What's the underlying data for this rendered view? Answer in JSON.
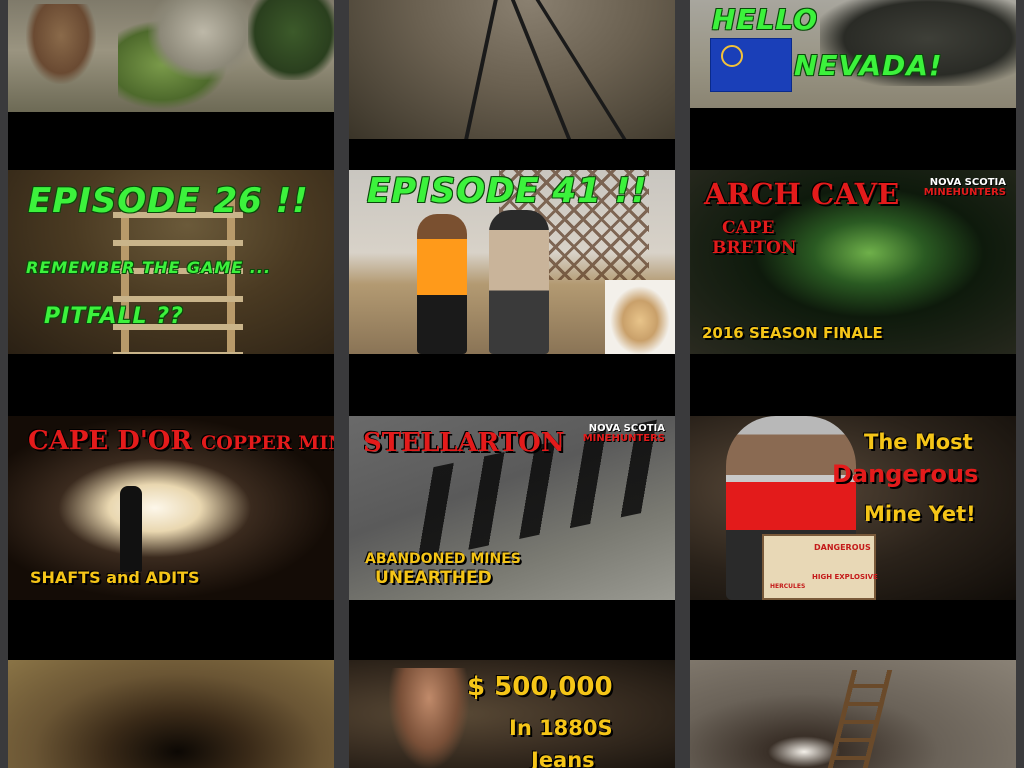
{
  "tiles": [
    {
      "id": "burros",
      "texts": []
    },
    {
      "id": "mine-rails",
      "texts": []
    },
    {
      "id": "hello-nevada",
      "texts": {
        "line1": "HELLO",
        "line2": "NEVADA!"
      }
    },
    {
      "id": "episode-26",
      "texts": {
        "title": "EPISODE 26 !!",
        "line1": "REMEMBER THE GAME ...",
        "line2": "PITFALL ??"
      }
    },
    {
      "id": "episode-41",
      "texts": {
        "title": "EPISODE 41 !!"
      }
    },
    {
      "id": "arch-cave",
      "texts": {
        "title": "ARCH CAVE",
        "sub1": "CAPE",
        "sub2": "BRETON",
        "footer": "2016 SEASON FINALE",
        "brand1": "NOVA SCOTIA",
        "brand2": "MINEHUNTERS"
      }
    },
    {
      "id": "cape-dor",
      "texts": {
        "title_big": "CAPE D'OR",
        "title_small": "COPPER MINES",
        "footer": "SHAFTS and ADITS"
      }
    },
    {
      "id": "stellarton",
      "texts": {
        "title": "STELLARTON",
        "footer1": "ABANDONED MINES",
        "footer2": "UNEARTHED",
        "brand1": "NOVA SCOTIA",
        "brand2": "MINEHUNTERS"
      }
    },
    {
      "id": "most-dangerous",
      "texts": {
        "line1": "The Most",
        "line2": "Dangerous",
        "line3": "Mine Yet!",
        "box1": "DANGEROUS",
        "box2": "HIGH EXPLOSIVE",
        "box3": "HERCULES"
      }
    },
    {
      "id": "tunnel",
      "texts": []
    },
    {
      "id": "500k-jeans",
      "texts": {
        "line1": "$ 500,000",
        "line2": "In 1880S",
        "line3": "Jeans"
      }
    },
    {
      "id": "ladder-shaft",
      "texts": []
    }
  ],
  "colors": {
    "column_background": "#000000",
    "gutter": "#3a3a3c",
    "green_text": "#3cf23c",
    "red_text": "#e31b1b",
    "yellow_text": "#f5c518"
  }
}
